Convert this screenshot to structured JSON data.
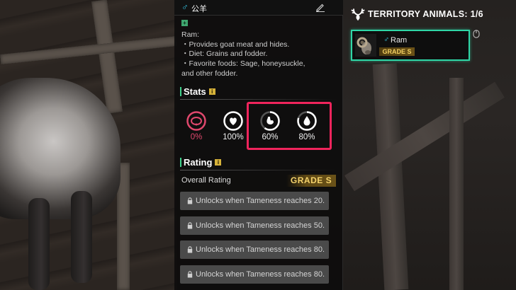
{
  "header": {
    "gender_symbol": "♂",
    "animal_name": "公羊",
    "edit_icon": "pencil-icon"
  },
  "description": {
    "badge": "+",
    "lines": [
      "Ram:",
      "・Provides goat meat and hides.",
      "・Diet: Grains and fodder.",
      "・Favorite foods: Sage, honeysuckle,",
      "and other fodder."
    ]
  },
  "stats": {
    "heading": "Stats",
    "info_icon": "i",
    "items": [
      {
        "icon": "collar-icon",
        "value": "0%",
        "level": 0
      },
      {
        "icon": "heart-icon",
        "value": "100%",
        "level": 1.0
      },
      {
        "icon": "stomach-icon",
        "value": "60%",
        "level": 0.6
      },
      {
        "icon": "water-drop-icon",
        "value": "80%",
        "level": 0.8
      }
    ]
  },
  "rating": {
    "heading": "Rating",
    "info_icon": "i",
    "overall_label": "Overall Rating",
    "grade": "GRADE S",
    "locked": [
      "Unlocks when Tameness reaches 20.",
      "Unlocks when Tameness reaches 50.",
      "Unlocks when Tameness reaches 80.",
      "Unlocks when Tameness reaches 80."
    ]
  },
  "territory": {
    "title": "TERRITORY ANIMALS: 1/6",
    "icon": "antler-icon",
    "card": {
      "gender_symbol": "♂",
      "name": "Ram",
      "grade": "GRADE S"
    }
  },
  "colors": {
    "accent_green": "#3fd08b",
    "male_blue": "#35c8e8",
    "grade_gold": "#f4d26b",
    "warning_pink": "#e0486d",
    "highlight_red": "#f0245c"
  }
}
